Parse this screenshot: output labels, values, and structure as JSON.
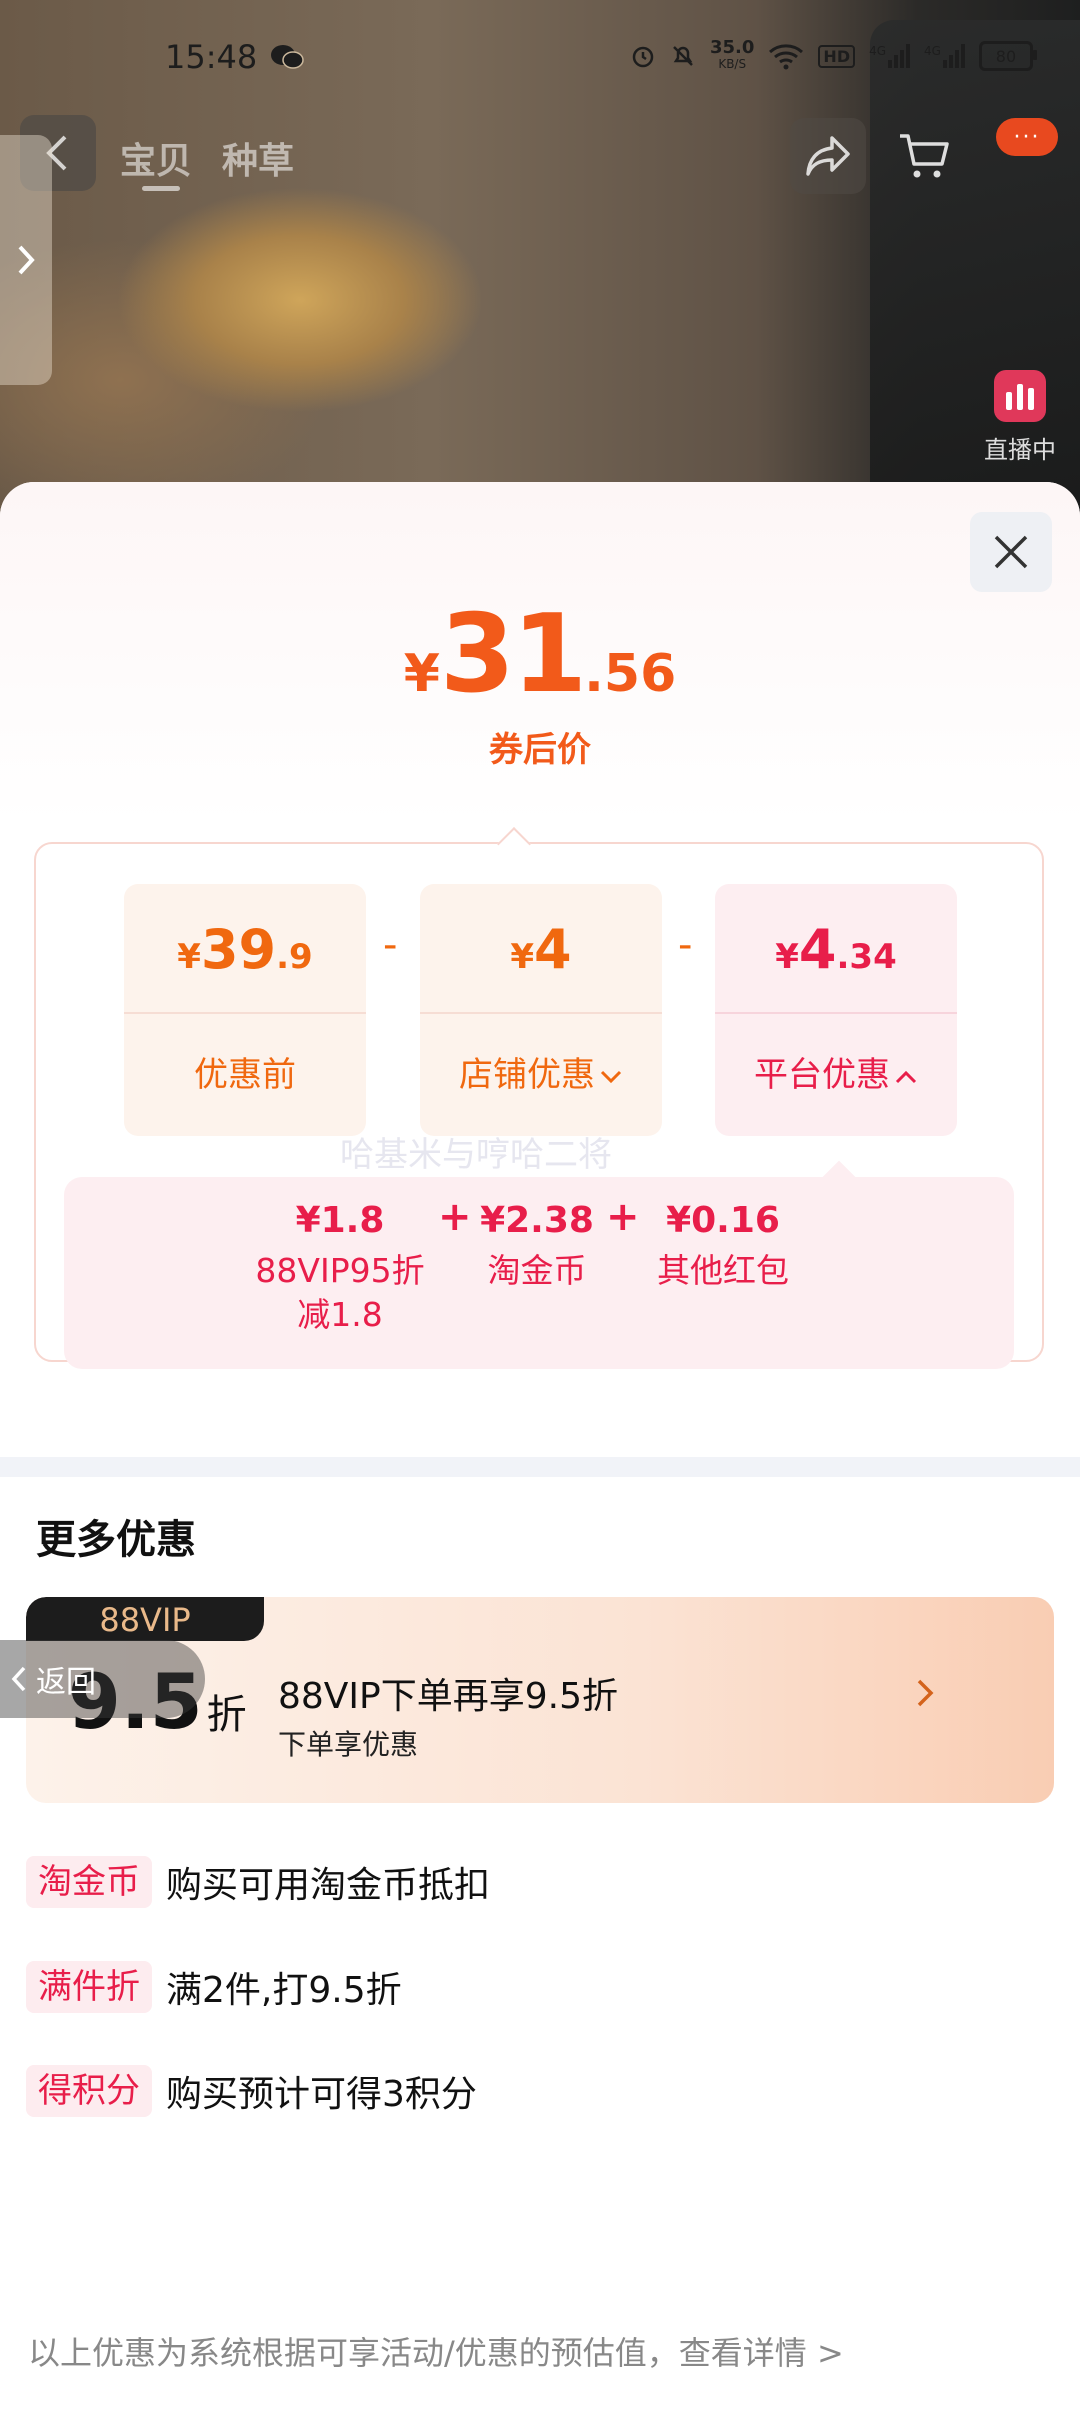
{
  "status_bar": {
    "time": "15:48",
    "net_speed": "35.0",
    "net_unit": "KB/S",
    "hd": "HD",
    "sig1": "4G",
    "sig2": "4G",
    "battery": "80",
    "icons": [
      "wechat-icon",
      "alarm-icon",
      "mute-icon",
      "wifi-icon",
      "signal-icon",
      "battery-icon"
    ]
  },
  "nav": {
    "tabs": [
      "宝贝",
      "种草"
    ],
    "live_label": "直播中",
    "more_badge": "···"
  },
  "price": {
    "yen": "¥",
    "int": "31",
    "dec": ".56",
    "label": "券后价"
  },
  "calc": {
    "items": [
      {
        "yen": "¥",
        "int": "39",
        "dec": ".9",
        "label": "优惠前"
      },
      {
        "yen": "¥",
        "int": "4",
        "dec": "",
        "label": "店铺优惠"
      },
      {
        "yen": "¥",
        "int": "4",
        "dec": ".34",
        "label": "平台优惠"
      }
    ],
    "operator": "-",
    "platform_breakdown": [
      {
        "value": "¥1.8",
        "name": "88VIP95折",
        "name2": "减1.8"
      },
      {
        "value": "¥2.38",
        "name": "淘金币",
        "name2": ""
      },
      {
        "value": "¥0.16",
        "name": "其他红包",
        "name2": ""
      }
    ],
    "plus": "+",
    "watermark": "哈基米与哼哈二将"
  },
  "more": {
    "title": "更多优惠",
    "vip": {
      "badge": "88VIP",
      "rate": "9.5",
      "rate_unit": "折",
      "title": "88VIP下单再享9.5折",
      "subtitle": "下单享优惠"
    },
    "back_label": "返回",
    "perks": [
      {
        "tag": "淘金币",
        "text": "购买可用淘金币抵扣"
      },
      {
        "tag": "满件折",
        "text": "满2件,打9.5折"
      },
      {
        "tag": "得积分",
        "text": "购买预计可得3积分"
      }
    ],
    "footnote": "以上优惠为系统根据可享活动/优惠的预估值，查看详情 >"
  },
  "colors": {
    "price_orange": "#f25a1a",
    "platform_red": "#e81e4a",
    "card_orange_bg": "#fdf3ec",
    "card_pink_bg": "#fdeef1"
  }
}
